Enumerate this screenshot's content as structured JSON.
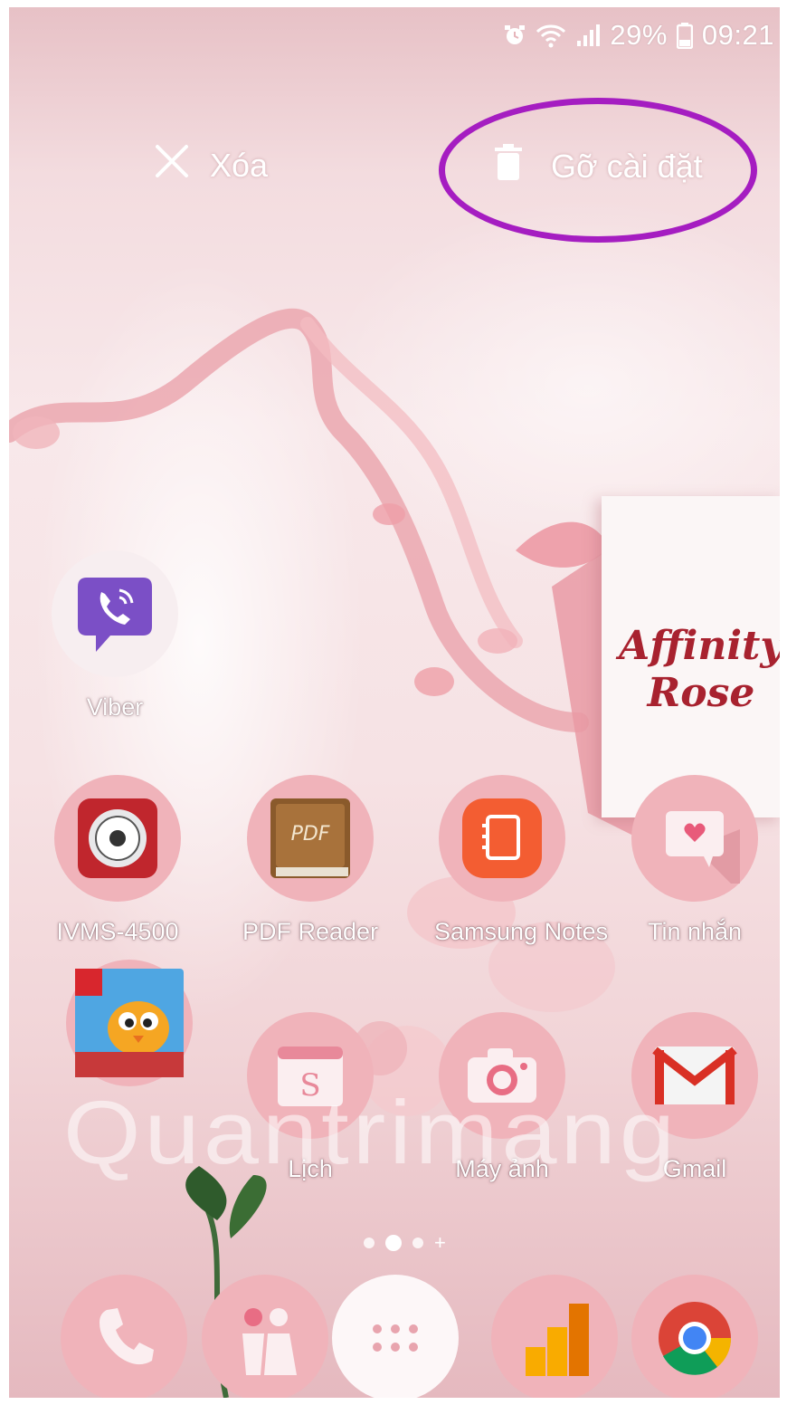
{
  "status_bar": {
    "battery": "29%",
    "time": "09:21"
  },
  "actions": {
    "remove_label": "Xóa",
    "uninstall_label": "Gỡ cài đặt"
  },
  "wallpaper": {
    "card_line1": "Affinity",
    "card_line2": "Rose"
  },
  "apps_row1": [
    {
      "label": "Viber"
    }
  ],
  "apps_row2": [
    {
      "label": "IVMS-4500"
    },
    {
      "label": "PDF Reader"
    },
    {
      "label": "Samsung Notes"
    },
    {
      "label": "Tin nhắn"
    }
  ],
  "apps_row3": [
    {
      "label": ""
    },
    {
      "label": "Lịch"
    },
    {
      "label": "Máy ảnh"
    },
    {
      "label": "Gmail"
    }
  ],
  "pdf_icon_text": "PDF",
  "calendar_icon_text": "S",
  "watermark": "Quantrimang",
  "colors": {
    "highlight": "#a51dc1",
    "icon_bg": "#f0b3ba"
  }
}
